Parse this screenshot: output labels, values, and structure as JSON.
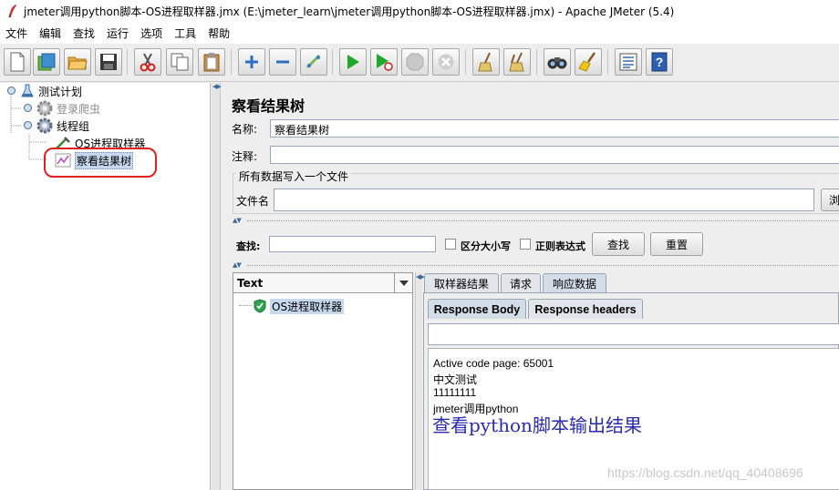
{
  "window": {
    "title": "jmeter调用python脚本-OS进程取样器.jmx (E:\\jmeter_learn\\jmeter调用python脚本-OS进程取样器.jmx) - Apache JMeter (5.4)"
  },
  "menu": [
    "文件",
    "编辑",
    "查找",
    "运行",
    "选项",
    "工具",
    "帮助"
  ],
  "toolbar": {
    "icons": [
      "new-icon",
      "templates-icon",
      "open-icon",
      "save-icon",
      "cut-icon",
      "copy-icon",
      "paste-icon",
      "expand-icon",
      "collapse-icon",
      "toggle-icon",
      "start-icon",
      "start-no-pause-icon",
      "stop-icon",
      "shutdown-icon",
      "clear-icon",
      "clear-all-icon",
      "search-icon",
      "reset-search-icon",
      "function-helper-icon",
      "help-icon"
    ]
  },
  "tree": {
    "nodes": [
      {
        "label": "测试计划",
        "enabled": true
      },
      {
        "label": "登录爬虫",
        "enabled": false
      },
      {
        "label": "线程组",
        "enabled": true
      },
      {
        "label": "OS进程取样器",
        "enabled": true
      },
      {
        "label": "察看结果树",
        "enabled": true,
        "selected": true
      }
    ]
  },
  "panel": {
    "title": "察看结果树",
    "name_label": "名称:",
    "name_value": "察看结果树",
    "comment_label": "注释:",
    "comment_value": "",
    "file_group_title": "所有数据写入一个文件",
    "file_label": "文件名",
    "file_value": "",
    "browse_label": "浏"
  },
  "search": {
    "label": "查找:",
    "value": "",
    "case_sensitive_label": "区分大小写",
    "regex_label": "正则表达式",
    "find_button": "查找",
    "reset_button": "重置"
  },
  "results": {
    "renderer": "Text",
    "items": [
      {
        "label": "OS进程取样器",
        "status": "success"
      }
    ],
    "tabs": [
      "取样器结果",
      "请求",
      "响应数据"
    ],
    "active_tab": "响应数据",
    "subtabs": [
      "Response Body",
      "Response headers"
    ],
    "active_subtab": "Response Body",
    "response_search_value": "",
    "body_lines": [
      "Active code page: 65001",
      "中文测试",
      "11111111",
      "jmeter调用python"
    ],
    "annotation": "查看python脚本输出结果"
  },
  "watermark": "https://blog.csdn.net/qq_40408696",
  "colors": {
    "selection": "#c7d9ef",
    "highlight_circle": "#e02020",
    "annotation": "#2a2bb0",
    "success": "#2ea44f"
  }
}
